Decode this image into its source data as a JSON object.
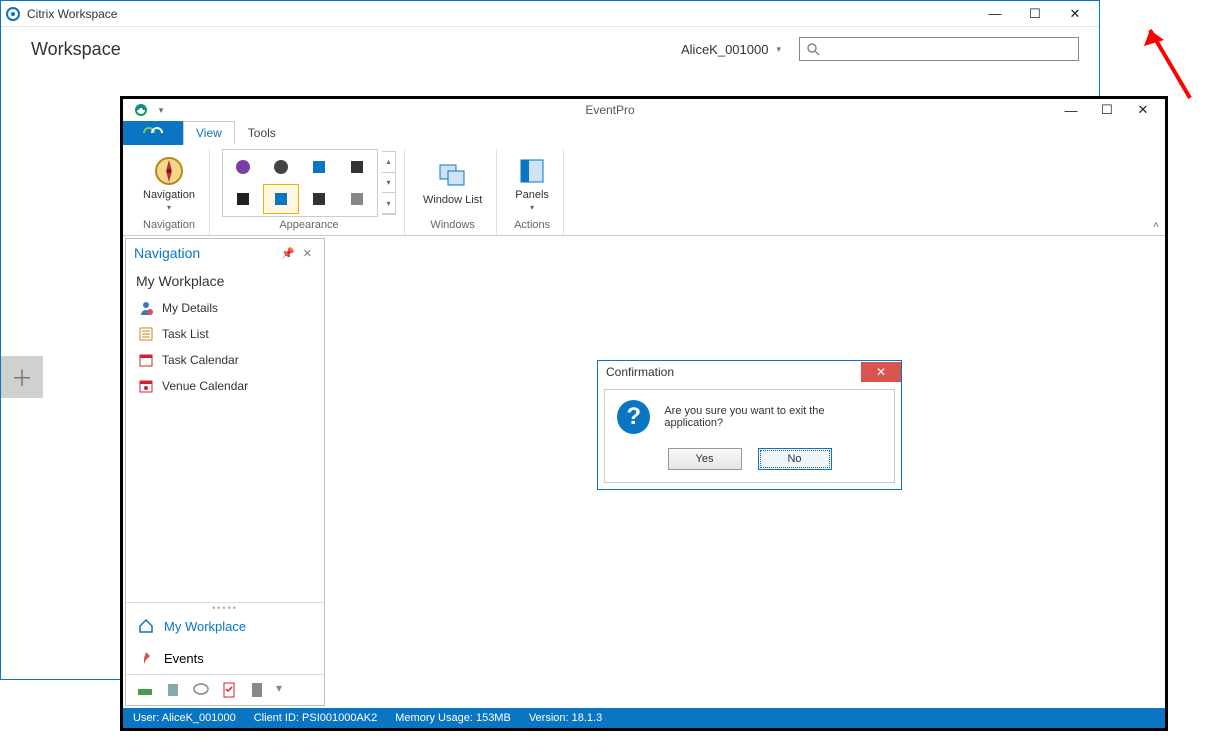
{
  "citrix": {
    "title": "Citrix Workspace",
    "workspace_label": "Workspace",
    "user": "AliceK_001000",
    "search_placeholder": ""
  },
  "eventpro": {
    "title": "EventPro",
    "tabs": {
      "view": "View",
      "tools": "Tools"
    },
    "ribbon": {
      "navigation_btn": "Navigation",
      "navigation_group": "Navigation",
      "appearance_group": "Appearance",
      "windowlist_btn": "Window List",
      "windows_group": "Windows",
      "panels_btn": "Panels",
      "actions_group": "Actions"
    },
    "nav": {
      "panel_title": "Navigation",
      "section": "My Workplace",
      "items": [
        "My Details",
        "Task List",
        "Task Calendar",
        "Venue Calendar"
      ],
      "bottom": {
        "workplace": "My Workplace",
        "events": "Events"
      }
    },
    "dialog": {
      "title": "Confirmation",
      "message": "Are you sure you want to exit the application?",
      "yes": "Yes",
      "no": "No"
    },
    "status": {
      "user": "User: AliceK_001000",
      "client": "Client ID: PSI001000AK2",
      "memory": "Memory Usage: 153MB",
      "version": "Version: 18.1.3"
    }
  }
}
